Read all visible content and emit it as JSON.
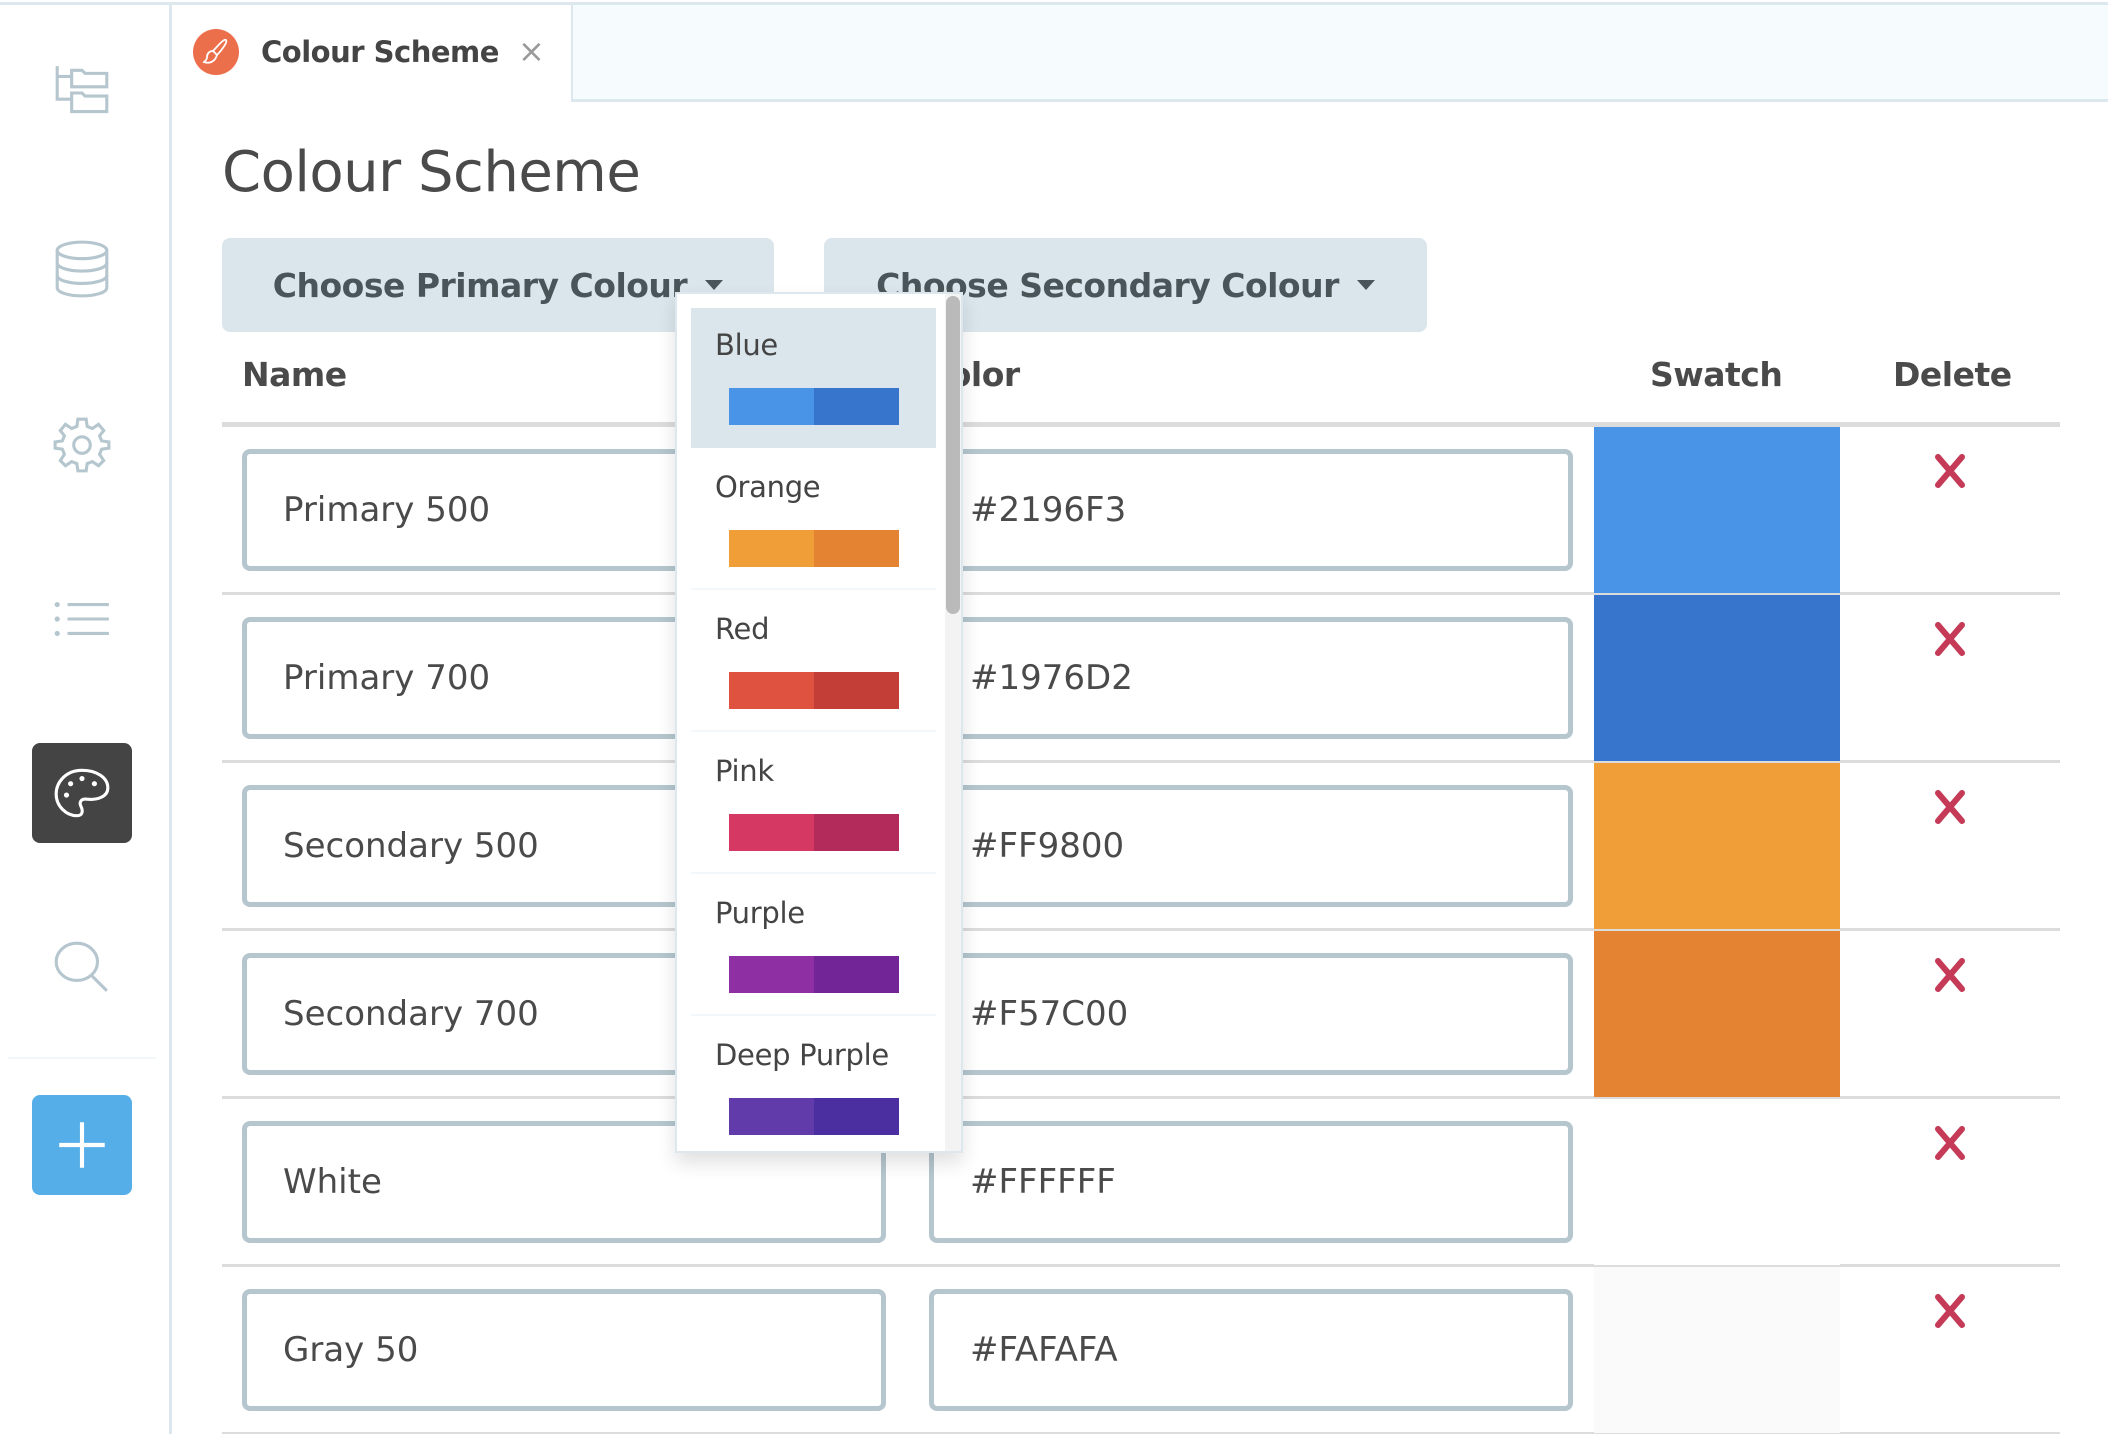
{
  "sidebar": {
    "items": [
      {
        "name": "folder-tree",
        "active": false
      },
      {
        "name": "database",
        "active": false
      },
      {
        "name": "settings",
        "active": false
      },
      {
        "name": "list",
        "active": false
      },
      {
        "name": "palette",
        "active": true
      },
      {
        "name": "search",
        "active": false
      }
    ],
    "add_button": "add"
  },
  "tabs": [
    {
      "label": "Colour Scheme",
      "icon": "paintbrush",
      "icon_color": "#EC6F4C",
      "closable": true,
      "close_glyph": "×"
    }
  ],
  "page": {
    "title": "Colour Scheme",
    "primary_button": "Choose Primary Colour",
    "secondary_button": "Choose Secondary Colour"
  },
  "table": {
    "headers": {
      "name": "Name",
      "color": "Color",
      "swatch": "Swatch",
      "delete": "Delete"
    },
    "rows": [
      {
        "name": "Primary 500",
        "hex": "#2196F3",
        "swatch": "#4A94E8"
      },
      {
        "name": "Primary 700",
        "hex": "#1976D2",
        "swatch": "#3775CC"
      },
      {
        "name": "Secondary 500",
        "hex": "#FF9800",
        "swatch": "#F09F38"
      },
      {
        "name": "Secondary 700",
        "hex": "#F57C00",
        "swatch": "#E48331"
      },
      {
        "name": "White",
        "hex": "#FFFFFF",
        "swatch": "#FFFFFF"
      },
      {
        "name": "Gray 50",
        "hex": "#FAFAFA",
        "swatch": "#FAFAFA"
      }
    ]
  },
  "dropdown": {
    "open": true,
    "hovered": "Blue",
    "options": [
      {
        "label": "Blue",
        "colors": [
          "#4A94E8",
          "#3775CC"
        ]
      },
      {
        "label": "Orange",
        "colors": [
          "#F09F38",
          "#E48331"
        ]
      },
      {
        "label": "Red",
        "colors": [
          "#E05240",
          "#C33E36"
        ]
      },
      {
        "label": "Pink",
        "colors": [
          "#D63864",
          "#B22B5A"
        ]
      },
      {
        "label": "Purple",
        "colors": [
          "#8E2FA3",
          "#722597"
        ]
      },
      {
        "label": "Deep Purple",
        "colors": [
          "#623BAA",
          "#4B2E9F"
        ]
      }
    ]
  },
  "colors": {
    "delete_icon": "#C43A57",
    "active_sidebar": "#444444",
    "add_button": "#55AEE8",
    "button_bg": "#DAE6EC",
    "field_border": "#B5C6CE"
  }
}
